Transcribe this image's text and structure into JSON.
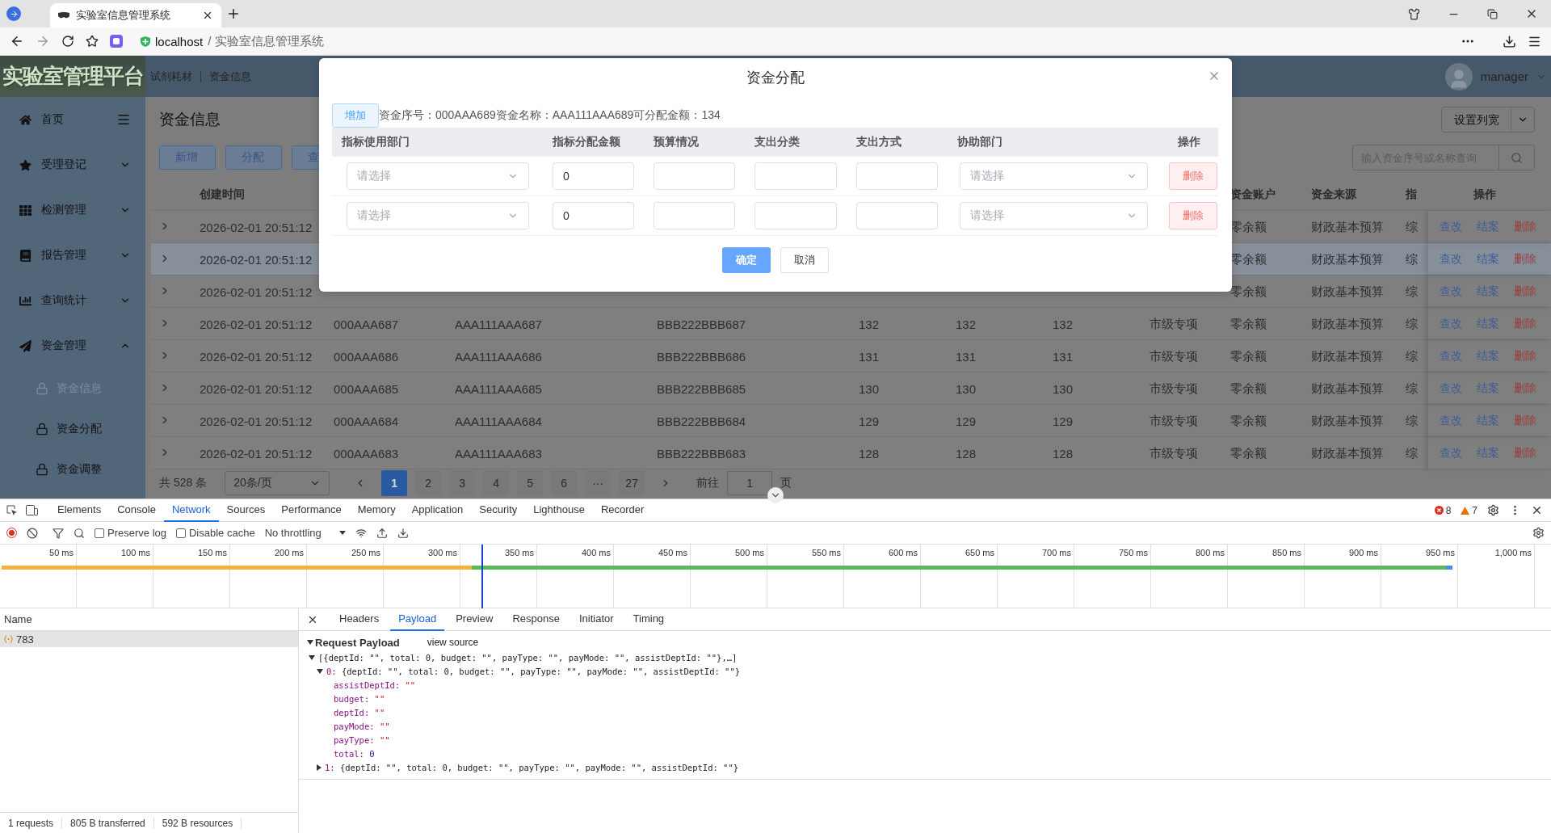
{
  "browser": {
    "tab": {
      "title": "实验室信息管理系统"
    },
    "address": {
      "host": "localhost",
      "path": "/ 实验室信息管理系统"
    }
  },
  "app": {
    "logo": "实验室管理平台",
    "breadcrumb": [
      "试剂耗材",
      "资金信息"
    ],
    "user": "manager",
    "sidebar": [
      {
        "label": "首页",
        "kind": "link"
      },
      {
        "label": "受理登记",
        "kind": "group",
        "expanded": false
      },
      {
        "label": "检测管理",
        "kind": "group",
        "expanded": false
      },
      {
        "label": "报告管理",
        "kind": "group",
        "expanded": false
      },
      {
        "label": "查询统计",
        "kind": "group",
        "expanded": false
      },
      {
        "label": "资金管理",
        "kind": "group",
        "expanded": true,
        "children": [
          {
            "label": "资金信息",
            "selected": true
          },
          {
            "label": "资金分配",
            "selected": false
          },
          {
            "label": "资金调整",
            "selected": false
          }
        ]
      }
    ],
    "page": {
      "title": "资金信息",
      "actions": [
        "新增",
        "分配",
        "查"
      ],
      "column_button": "设置列宽",
      "search": {
        "placeholder": "输入资金序号或名称查询"
      },
      "table": {
        "header": {
          "created": "创建时间",
          "account": "资金账户",
          "source": "资金来源",
          "col_12": "指",
          "actions": "操作"
        },
        "rows": [
          {
            "selected": false,
            "created": "2026-02-01 20:51:12",
            "account": "零余额",
            "source": "财政基本预算",
            "col_12": "综",
            "actions": [
              "查改",
              "结案",
              "删除"
            ]
          },
          {
            "selected": true,
            "created": "2026-02-01 20:51:12",
            "account": "零余额",
            "source": "财政基本预算",
            "col_12": "综",
            "actions": [
              "查改",
              "结案",
              "删除"
            ]
          },
          {
            "selected": false,
            "created": "2026-02-01 20:51:12",
            "account": "零余额",
            "source": "财政基本预算",
            "col_12": "综",
            "actions": [
              "查改",
              "结案",
              "删除"
            ]
          },
          {
            "selected": false,
            "created": "2026-02-01 20:51:12",
            "seq": "000AAA687",
            "name": "AAA111AAA687",
            "code": "BBB222BBB687",
            "col_6": "132",
            "col_7": "132",
            "col_8": "132",
            "category": "市级专项",
            "account": "零余额",
            "source": "财政基本预算",
            "col_12": "综",
            "actions": [
              "查改",
              "结案",
              "删除"
            ]
          },
          {
            "selected": false,
            "created": "2026-02-01 20:51:12",
            "seq": "000AAA686",
            "name": "AAA111AAA686",
            "code": "BBB222BBB686",
            "col_6": "131",
            "col_7": "131",
            "col_8": "131",
            "category": "市级专项",
            "account": "零余额",
            "source": "财政基本预算",
            "col_12": "综",
            "actions": [
              "查改",
              "结案",
              "删除"
            ]
          },
          {
            "selected": false,
            "created": "2026-02-01 20:51:12",
            "seq": "000AAA685",
            "name": "AAA111AAA685",
            "code": "BBB222BBB685",
            "col_6": "130",
            "col_7": "130",
            "col_8": "130",
            "category": "市级专项",
            "account": "零余额",
            "source": "财政基本预算",
            "col_12": "综",
            "actions": [
              "查改",
              "结案",
              "删除"
            ]
          },
          {
            "selected": false,
            "created": "2026-02-01 20:51:12",
            "seq": "000AAA684",
            "name": "AAA111AAA684",
            "code": "BBB222BBB684",
            "col_6": "129",
            "col_7": "129",
            "col_8": "129",
            "category": "市级专项",
            "account": "零余额",
            "source": "财政基本预算",
            "col_12": "综",
            "actions": [
              "查改",
              "结案",
              "删除"
            ]
          },
          {
            "selected": false,
            "created": "2026-02-01 20:51:12",
            "seq": "000AAA683",
            "name": "AAA111AAA683",
            "code": "BBB222BBB683",
            "col_6": "128",
            "col_7": "128",
            "col_8": "128",
            "category": "市级专项",
            "account": "零余额",
            "source": "财政基本预算",
            "col_12": "综",
            "actions": [
              "查改",
              "结案",
              "删除"
            ]
          }
        ]
      },
      "pagination": {
        "total": "共 528 条",
        "page_size": "20条/页",
        "pages": [
          {
            "label": "1",
            "selected": true
          },
          {
            "label": "2",
            "selected": false
          },
          {
            "label": "3",
            "selected": false
          },
          {
            "label": "4",
            "selected": false
          },
          {
            "label": "5",
            "selected": false
          },
          {
            "label": "6",
            "selected": false
          },
          {
            "label": "···",
            "selected": false
          },
          {
            "label": "27",
            "selected": false
          }
        ],
        "goto_label": "前往",
        "goto_value": "1",
        "page_unit": "页"
      }
    },
    "dialog": {
      "title": "资金分配",
      "add_button": "增加",
      "info": "资金序号：000AAA689资金名称：AAA111AAA689可分配金额：134",
      "columns": [
        "指标使用部门",
        "指标分配金额",
        "预算情况",
        "支出分类",
        "支出方式",
        "协助部门",
        "操作"
      ],
      "rows": [
        {
          "dept": {
            "placeholder": "请选择"
          },
          "amount": "0",
          "assist": {
            "placeholder": "请选择"
          },
          "delete": "删除"
        },
        {
          "dept": {
            "placeholder": "请选择"
          },
          "amount": "0",
          "assist": {
            "placeholder": "请选择"
          },
          "delete": "删除"
        }
      ],
      "confirm": "确定",
      "cancel": "取消"
    }
  },
  "devtools": {
    "tabs": [
      {
        "label": "Elements",
        "selected": false
      },
      {
        "label": "Console",
        "selected": false
      },
      {
        "label": "Network",
        "selected": true
      },
      {
        "label": "Sources",
        "selected": false
      },
      {
        "label": "Performance",
        "selected": false
      },
      {
        "label": "Memory",
        "selected": false
      },
      {
        "label": "Application",
        "selected": false
      },
      {
        "label": "Security",
        "selected": false
      },
      {
        "label": "Lighthouse",
        "selected": false
      },
      {
        "label": "Recorder",
        "selected": false
      }
    ],
    "errors": "8",
    "warnings": "7",
    "toolbar": {
      "preserve_log": {
        "label": "Preserve log",
        "checked": false
      },
      "disable_cache": {
        "label": "Disable cache",
        "checked": false
      },
      "throttling": "No throttling"
    },
    "timeline": {
      "ticks": [
        "50 ms",
        "100 ms",
        "150 ms",
        "200 ms",
        "250 ms",
        "300 ms",
        "350 ms",
        "400 ms",
        "450 ms",
        "500 ms",
        "550 ms",
        "600 ms",
        "650 ms",
        "700 ms",
        "750 ms",
        "800 ms",
        "850 ms",
        "900 ms",
        "950 ms",
        "1,000 ms"
      ]
    },
    "requests": {
      "header": "Name",
      "items": [
        {
          "name": "783",
          "selected": true
        }
      ]
    },
    "detail": {
      "tabs": [
        {
          "label": "Headers",
          "selected": false
        },
        {
          "label": "Payload",
          "selected": true
        },
        {
          "label": "Preview",
          "selected": false
        },
        {
          "label": "Response",
          "selected": false
        },
        {
          "label": "Initiator",
          "selected": false
        },
        {
          "label": "Timing",
          "selected": false
        }
      ],
      "payload": {
        "title": "Request Payload",
        "view_source": "view source",
        "root": {
          "summary": "[{deptId: \"\", total: 0, budget: \"\", payType: \"\", payMode: \"\", assistDeptId: \"\"},…]",
          "expanded": true,
          "children": [
            {
              "key": "0:",
              "summary": "{deptId: \"\", total: 0, budget: \"\", payType: \"\", payMode: \"\", assistDeptId: \"\"}",
              "expanded": true,
              "props": [
                {
                  "key": "assistDeptId:",
                  "value": "\"\"",
                  "kind": "string"
                },
                {
                  "key": "budget:",
                  "value": "\"\"",
                  "kind": "string"
                },
                {
                  "key": "deptId:",
                  "value": "\"\"",
                  "kind": "string"
                },
                {
                  "key": "payMode:",
                  "value": "\"\"",
                  "kind": "string"
                },
                {
                  "key": "payType:",
                  "value": "\"\"",
                  "kind": "string"
                },
                {
                  "key": "total:",
                  "value": "0",
                  "kind": "number"
                }
              ]
            },
            {
              "key": "1:",
              "summary": "{deptId: \"\", total: 0, budget: \"\", payType: \"\", payMode: \"\", assistDeptId: \"\"}",
              "expanded": false
            }
          ]
        }
      }
    },
    "status": [
      "1 requests",
      "805 B transferred",
      "592 B resources"
    ]
  }
}
